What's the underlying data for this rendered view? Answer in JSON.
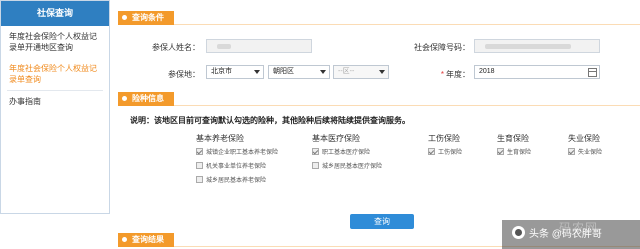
{
  "sidebar": {
    "title": "社保查询",
    "items": [
      {
        "label": "年度社会保险个人权益记录单开通地区查询",
        "active": false
      },
      {
        "label": "年度社会保险个人权益记录单查询",
        "active": true
      },
      {
        "label": "办事指南",
        "active": false
      }
    ]
  },
  "sections": {
    "query_conditions": "查询条件",
    "insurance_info": "险种信息",
    "query_results": "查询结果"
  },
  "form": {
    "name_label": "参保人姓名：",
    "ssn_label": "社会保障号码：",
    "location_label": "参保地：",
    "city": "北京市",
    "district": "朝阳区",
    "area_placeholder": "--区--",
    "year_label": "年度：",
    "year_value": "2018"
  },
  "notice": "说明：该地区目前可查询默认勾选的险种，其他险种后续将陆续提供查询服务。",
  "insurance": {
    "pension": {
      "title": "基本养老保险",
      "items": [
        {
          "label": "城镇企业职工基本养老保险",
          "checked": true
        },
        {
          "label": "机关事业单位养老保险",
          "checked": false
        },
        {
          "label": "城乡居民基本养老保险",
          "checked": false
        }
      ]
    },
    "medical": {
      "title": "基本医疗保险",
      "items": [
        {
          "label": "职工基本医疗保险",
          "checked": true
        },
        {
          "label": "城乡居民基本医疗保险",
          "checked": false
        }
      ]
    },
    "injury": {
      "title": "工伤保险",
      "items": [
        {
          "label": "工伤保险",
          "checked": true
        }
      ]
    },
    "maternity": {
      "title": "生育保险",
      "items": [
        {
          "label": "生育保险",
          "checked": true
        }
      ]
    },
    "unemployment": {
      "title": "失业保险",
      "items": [
        {
          "label": "失业保险",
          "checked": true
        }
      ]
    }
  },
  "buttons": {
    "query": "查询"
  },
  "watermark": {
    "text": "头条 @码农胖哥",
    "ghost": "码农网"
  },
  "colors": {
    "accent_orange": "#f39a2b",
    "primary_blue": "#2f7fc1",
    "button_blue": "#2f8cd8",
    "active_link": "#f08a1c"
  }
}
